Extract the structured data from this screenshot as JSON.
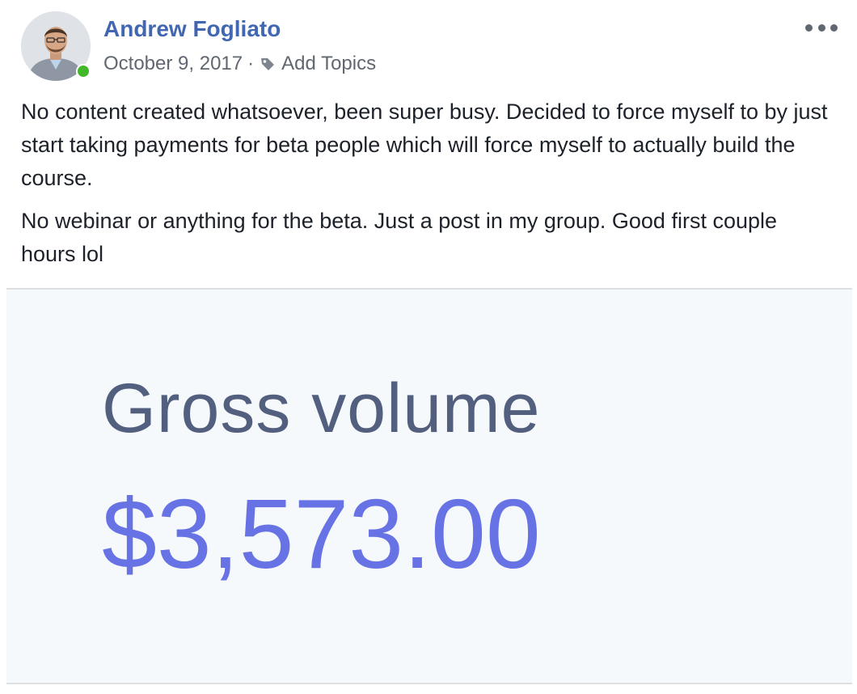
{
  "post": {
    "author_name": "Andrew Fogliato",
    "date": "October 9, 2017",
    "separator": "·",
    "topics_label": "Add Topics",
    "paragraphs": [
      "No content created whatsoever, been super busy. Decided to force myself to by just start taking payments for beta people which will force myself to actually build the course.",
      "No webinar or anything for the beta. Just a post in my group. Good first couple hours lol"
    ],
    "icons": {
      "avatar": "profile-photo",
      "status": "online-dot",
      "tag": "tag-icon",
      "more": "more-options-icon"
    }
  },
  "attachment": {
    "label": "Gross volume",
    "value": "$3,573.00"
  },
  "colors": {
    "author_link": "#4267b2",
    "meta_text": "#616770",
    "online": "#42b72a",
    "gross_label": "#525f7f",
    "gross_value": "#6772e5",
    "panel_bg": "#f6f9fc"
  }
}
